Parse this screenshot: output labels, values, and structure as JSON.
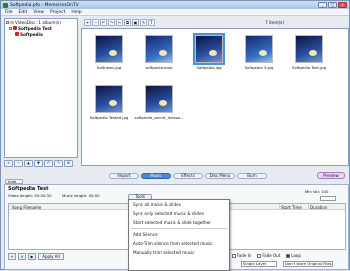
{
  "window": {
    "title": "Softpedia.pfo - MemoriesOnTV",
    "buttons": [
      "_",
      "□",
      "x"
    ]
  },
  "menu": [
    "File",
    "Edit",
    "View",
    "Project",
    "Help"
  ],
  "tree": {
    "root": "VideoDisc: 1 album(s)",
    "album": "Softpedia Test",
    "item": "Softpedia"
  },
  "toolbar": {
    "files_count": "7 item(s)"
  },
  "thumbnails": [
    {
      "label": "Softnews.jpg"
    },
    {
      "label": "softpedia.bmp"
    },
    {
      "label": "Softpedia.jpg"
    },
    {
      "label": "Softpedia 3.jpg"
    },
    {
      "label": "Softpedia Text.jpg"
    },
    {
      "label": "Softpedia Tested.jpg"
    },
    {
      "label": "softpedia_secret_messa..."
    }
  ],
  "tabs": [
    "Import",
    "Music",
    "Effects",
    "Disc Menu",
    "Burn"
  ],
  "active_tab": "Music",
  "preview": "Preview",
  "hide_tab": "hide",
  "panel": {
    "title": "Softpedia Test",
    "video_length": "Video length: 00:00:30",
    "music_length": "Music length: 00:00",
    "tools": "Tools",
    "min_vol_label": "Min Vol: 100",
    "vol_value": "",
    "columns": [
      "Song Filename",
      "Start Time",
      "Duration"
    ],
    "apply_all": "Apply All",
    "fade_in": "Fade In",
    "fade_out": "Fade Out",
    "loop": "Loop",
    "layer": "Single Layer",
    "original": "Don't store Original Files"
  },
  "dropdown": [
    "Sync all music & slides",
    "Sync only selected music & slides",
    "Start selected music & slide together",
    "Add Silence",
    "Auto-Trim silence from selected music",
    "Manually trim selected music"
  ]
}
